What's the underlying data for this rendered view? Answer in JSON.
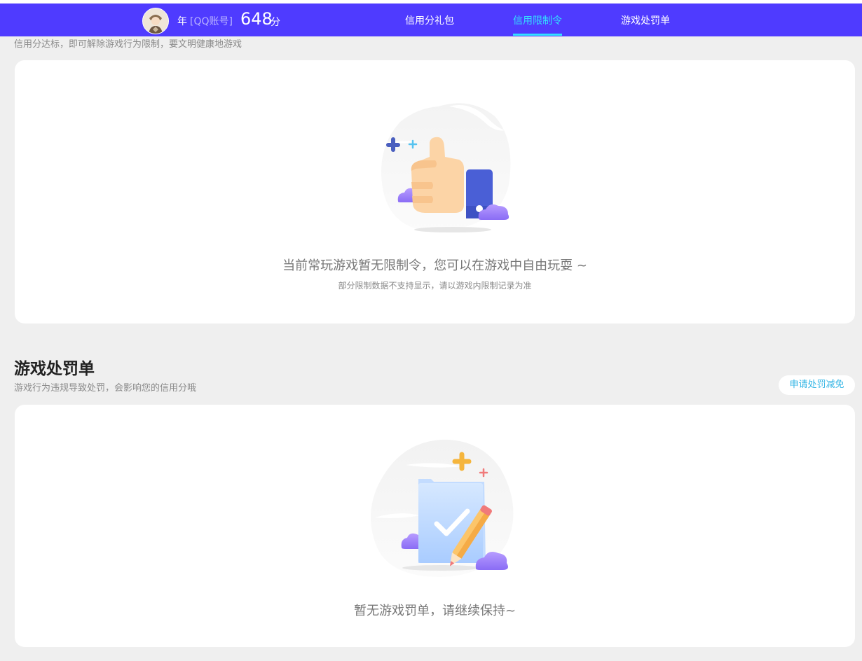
{
  "header": {
    "user_year": "年",
    "user_account": "[QQ账号]",
    "score": "648",
    "score_unit": "分",
    "tabs": [
      {
        "label": "信用分礼包",
        "active": false
      },
      {
        "label": "信用限制令",
        "active": true
      },
      {
        "label": "游戏处罚单",
        "active": false
      }
    ],
    "brand_color": "#4f3bff",
    "active_tab_color": "#33e0ff"
  },
  "restriction": {
    "description": "信用分达标，即可解除游戏行为限制，要文明健康地游戏",
    "empty_icon": "thumbs-up-illustration",
    "empty_message": "当前常玩游戏暂无限制令，您可以在游戏中自由玩耍 ~",
    "empty_note": "部分限制数据不支持显示，请以游戏内限制记录为准"
  },
  "penalty": {
    "title": "游戏处罚单",
    "description": "游戏行为违规导致处罚，会影响您的信用分哦",
    "apply_button": "申请处罚减免",
    "empty_icon": "clipboard-check-illustration",
    "empty_message": "暂无游戏罚单，请继续保持~"
  }
}
